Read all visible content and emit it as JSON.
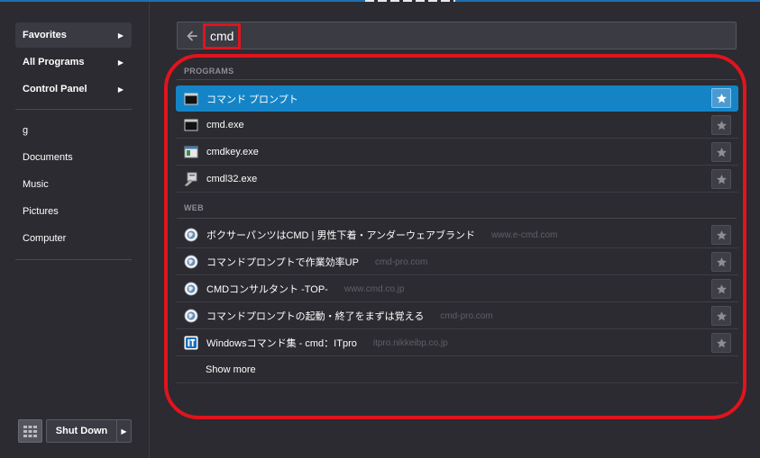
{
  "sidebar": {
    "menu": [
      {
        "label": "Favorites"
      },
      {
        "label": "All Programs"
      },
      {
        "label": "Control Panel"
      }
    ],
    "links": [
      {
        "label": "g"
      },
      {
        "label": "Documents"
      },
      {
        "label": "Music"
      },
      {
        "label": "Pictures"
      },
      {
        "label": "Computer"
      }
    ],
    "shutdown_label": "Shut Down"
  },
  "search": {
    "value": "cmd"
  },
  "programs": {
    "header": "PROGRAMS",
    "items": [
      {
        "label": "コマンド プロンプト",
        "icon": "console-icon"
      },
      {
        "label": "cmd.exe",
        "icon": "console-icon"
      },
      {
        "label": "cmdkey.exe",
        "icon": "app-window-icon"
      },
      {
        "label": "cmdl32.exe",
        "icon": "installer-icon"
      }
    ]
  },
  "web": {
    "header": "WEB",
    "items": [
      {
        "label": "ボクサーパンツはCMD | 男性下着・アンダーウェアブランド",
        "url": "www.e-cmd.com",
        "icon": "globe-icon"
      },
      {
        "label": "コマンドプロンプトで作業効率UP",
        "url": "cmd-pro.com",
        "icon": "globe-icon"
      },
      {
        "label": "CMDコンサルタント -TOP-",
        "url": "www.cmd.co.jp",
        "icon": "globe-icon"
      },
      {
        "label": "コマンドプロンプトの起動・終了をまずは覚える",
        "url": "cmd-pro.com",
        "icon": "globe-icon"
      },
      {
        "label": "Windowsコマンド集 - cmd：ITpro",
        "url": "itpro.nikkeibp.co.jp",
        "icon": "itpro-icon"
      }
    ],
    "show_more": "Show more"
  },
  "colors": {
    "accent": "#1584c7",
    "annotation": "#e0141e",
    "background": "#2b2b31"
  }
}
